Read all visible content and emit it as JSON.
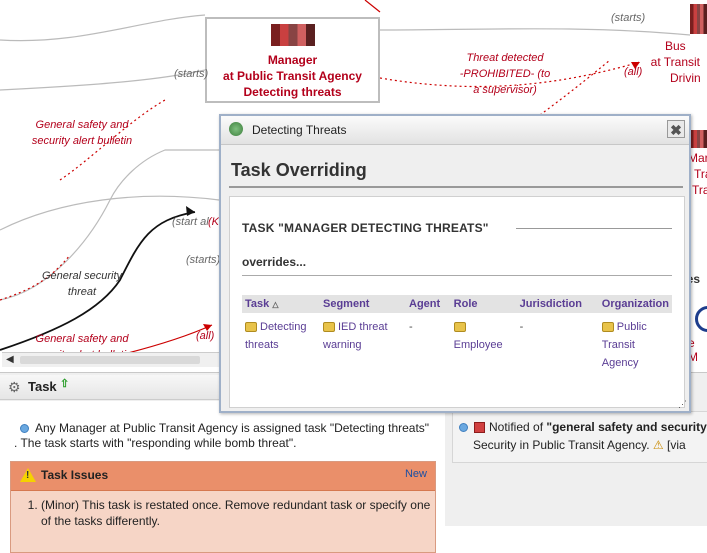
{
  "canvas": {
    "manager_node": {
      "line1": "Manager",
      "line2": "at Public Transit Agency",
      "line3": "Detecting threats"
    },
    "bus_node": {
      "line1": "Bus",
      "line2": "at Transit",
      "line3": "Drivin"
    },
    "right_partial": {
      "line1": "Mar",
      "line2": "Tra",
      "line3": "Tra",
      "line4": "res",
      "line5": "e M"
    },
    "edge_labels": {
      "starts_top_right": "(starts)",
      "starts_left": "(starts)",
      "starts_mid": "(start al",
      "starts_lower": "(starts)",
      "threat_detected_1": "Threat detected",
      "threat_detected_2": "-PROHIBITED- (to",
      "threat_detected_3": "a supervisor)",
      "all_top": "(all)",
      "all_bottom": "(all)",
      "general_safety_1a": "General safety and",
      "general_safety_1b": "security alert bulletin",
      "general_security_a": "General security",
      "general_security_b": "threat",
      "general_safety_2a": "General safety and",
      "general_safety_2b": "security alert bulletin",
      "partial_k": "(K"
    }
  },
  "task_tab": {
    "label": "Task",
    "assignment_text": "Any Manager at Public Transit Agency is assigned task \"Detecting threats\"",
    "assignment_line2": ". The task starts with \"responding while bomb threat\".",
    "issues": {
      "title": "Task Issues",
      "new_link": "New",
      "items": [
        "(Minor) This task is restated once. Remove redundant task or specify one of the tasks differently."
      ]
    }
  },
  "right_panel": {
    "notified_prefix": "Notified of ",
    "notified_bold": "\"general safety and security",
    "line2": "Security in Public Transit Agency.",
    "via": "[via"
  },
  "dialog": {
    "title": "Detecting Threats",
    "close_glyph": "✖",
    "heading": "Task Overriding",
    "task_name": "TASK \"MANAGER DETECTING THREATS\"",
    "overrides_label": "overrides...",
    "columns": [
      "Task",
      "Segment",
      "Agent",
      "Role",
      "Jurisdiction",
      "Organization"
    ],
    "rows": [
      {
        "task": "Detecting threats",
        "segment": "IED threat warning",
        "agent": "-",
        "role": "Employee",
        "jurisdiction": "-",
        "organization": "Public Transit Agency"
      }
    ],
    "resize_glyph": "⋰"
  },
  "colors": {
    "accent_red": "#b3001b",
    "link_purple": "#5a3d94",
    "issues_header": "#ea8f6a"
  }
}
